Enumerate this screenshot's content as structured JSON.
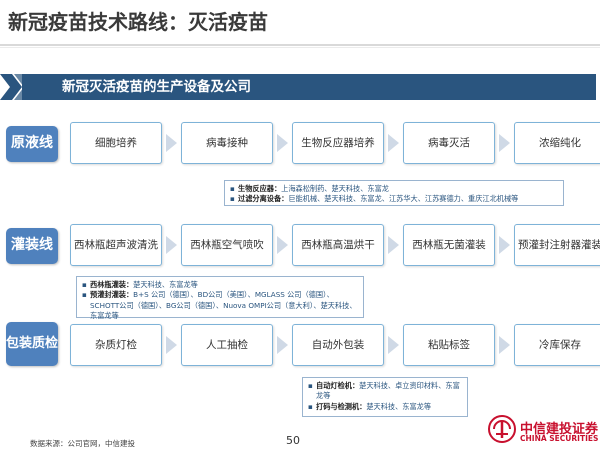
{
  "page_title": "新冠疫苗技术路线：灭活疫苗",
  "banner_title": "新冠灭活疫苗的生产设备及公司",
  "stages": [
    {
      "label": "原液线",
      "steps": [
        "细胞培养",
        "病毒接种",
        "生物反应器培养",
        "病毒灭活",
        "浓缩纯化"
      ],
      "note": [
        {
          "head": "生物反应器：",
          "text": "上海森松制药、楚天科技、东富龙"
        },
        {
          "head": "过滤分离设备：",
          "text": "巨能机械、楚天科技、东富龙、江苏华大、江苏赛德力、重庆江北机械等"
        }
      ]
    },
    {
      "label": "灌装线",
      "steps": [
        "西林瓶超声波清洗",
        "西林瓶空气喷吹",
        "西林瓶高温烘干",
        "西林瓶无菌灌装",
        "预灌封注射器灌装"
      ],
      "note": [
        {
          "head": "西林瓶灌装：",
          "text": "楚天科技、东富龙等"
        },
        {
          "head": "预灌封灌装：",
          "text": "B+S 公司（德国）、BD公司（美国）、MGLASS 公司（德国）、SCHOTT公司（德国）、BG公司（德国）、Nuova OMPI公司（意大利）、楚天科技、东富龙等"
        }
      ]
    },
    {
      "label": "包装质检",
      "steps": [
        "杂质灯检",
        "人工抽检",
        "自动外包装",
        "粘贴标签",
        "冷库保存"
      ],
      "note": [
        {
          "head": "自动灯检机：",
          "text": "楚天科技、卓立资印材料、东富龙等"
        },
        {
          "head": "打码与检测机：",
          "text": "楚天科技、东富龙等"
        }
      ]
    }
  ],
  "footer": {
    "source": "数据来源：公司官网，中信建投",
    "page_number": "50",
    "logo_cn": "中信建投证券",
    "logo_en": "CHINA SECURITIES"
  },
  "colors": {
    "banner": "#2a557f",
    "stage": "#4f81bd",
    "step_border": "#7eb3d8",
    "arrow": "#cfd9e6",
    "logo": "#c8102e"
  }
}
